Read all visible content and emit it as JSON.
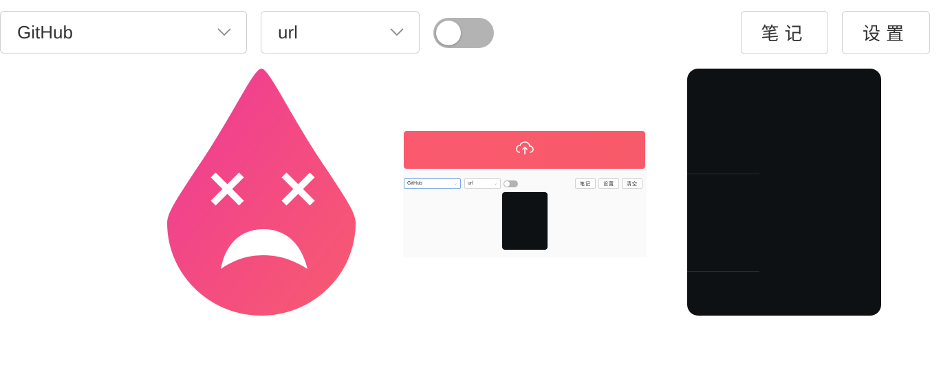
{
  "toolbar": {
    "platform_select": {
      "value": "GitHub"
    },
    "format_select": {
      "value": "url"
    },
    "toggle": {
      "on": false
    },
    "notes_label": "笔记",
    "settings_label": "设置"
  },
  "preview": {
    "platform_value": "GitHub",
    "format_value": "url",
    "notes_label": "笔记",
    "settings_label": "设置",
    "clear_label": "清空"
  },
  "colors": {
    "accent_gradient_start": "#ee3a97",
    "accent_gradient_end": "#f85b6f",
    "upload_bar": "#fb5a6e",
    "dark_panel": "#0e1114"
  },
  "icons": {
    "dropdown": "chevron-down-icon",
    "upload": "cloud-upload-icon",
    "error_face": "sad-drop-icon"
  }
}
